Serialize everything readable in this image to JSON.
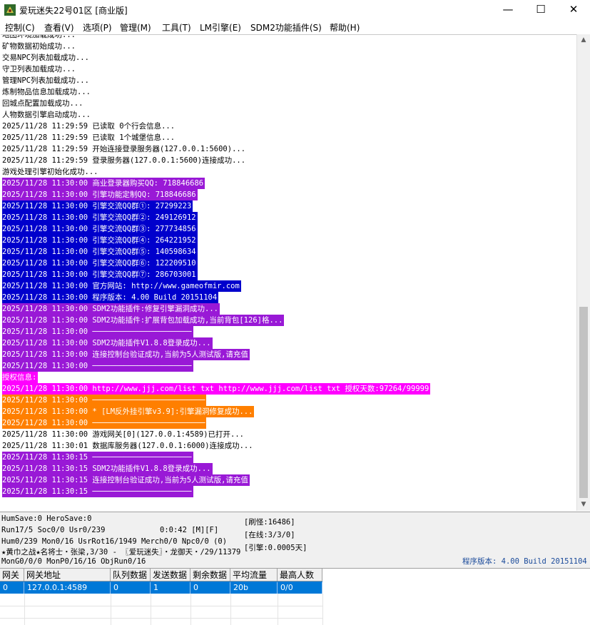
{
  "window": {
    "title": "爱玩迷失22号01区 [商业版]",
    "minimize": "—",
    "maximize": "☐",
    "close": "✕"
  },
  "menu": [
    "控制(C)",
    "查看(V)",
    "选项(P)",
    "管理(M)",
    "工具(T)",
    "LM引擎(E)",
    "SDM2功能插件(S)",
    "帮助(H)"
  ],
  "log_lines": [
    "地图环境加载成功...",
    "矿物数据初始成功...",
    "交易NPC列表加载成功...",
    "守卫列表加载成功...",
    "管理NPC列表加载成功...",
    "炼制物品信息加载成功...",
    "回城点配置加载成功...",
    "人物数据引擎启动成功...",
    "2025/11/28 11:29:59 已读取 0个行会信息...",
    "2025/11/28 11:29:59 已读取 1个城堡信息...",
    "2025/11/28 11:29:59 开始连接登录服务器(127.0.0.1:5600)...",
    "2025/11/28 11:29:59 登录服务器(127.0.0.1:5600)连接成功...",
    "游戏处理引擎初始化成功...",
    "2025/11/28 11:30:00 商业登录器购买QQ: 718846686",
    "2025/11/28 11:30:00 引擎功能定制QQ: 718846686",
    "2025/11/28 11:30:00 引擎交流QQ群①: 27299223",
    "2025/11/28 11:30:00 引擎交流QQ群②: 249126912",
    "2025/11/28 11:30:00 引擎交流QQ群③: 277734856",
    "2025/11/28 11:30:00 引擎交流QQ群④: 264221952",
    "2025/11/28 11:30:00 引擎交流QQ群⑤: 140598634",
    "2025/11/28 11:30:00 引擎交流QQ群⑥: 122209510",
    "2025/11/28 11:30:00 引擎交流QQ群⑦: 286703001",
    "2025/11/28 11:30:00 官方网站: http://www.gameofmir.com",
    "2025/11/28 11:30:00 程序版本: 4.00 Build 20151104",
    "2025/11/28 11:30:00 SDM2功能插件:修复引擎漏洞成功...",
    "2025/11/28 11:30:00 SDM2功能插件:扩展背包加载成功,当前背包[126]格...",
    "2025/11/28 11:30:00 ──────────────────────",
    "2025/11/28 11:30:00 SDM2功能插件V1.8.8登录成功...",
    "2025/11/28 11:30:00 连接控制台验证成功,当前为5人测试版,请充值",
    "2025/11/28 11:30:00 ──────────────────────",
    "授权信息:",
    "2025/11/28 11:30:00 http://www.jjj.com/list txt http://www.jjj.com/list txt 授权天数:97264/99999",
    "2025/11/28 11:30:00 ─────────────────────────",
    "2025/11/28 11:30:00 * [LM反外挂引擎v3.9]:引擎漏洞修复成功...",
    "2025/11/28 11:30:00 ─────────────────────────",
    "2025/11/28 11:30:00 游戏网关[0](127.0.0.1:4589)已打开...",
    "2025/11/28 11:30:01 数据库服务器(127.0.0.1:6000)连接成功...",
    "2025/11/28 11:30:15 ──────────────────────",
    "2025/11/28 11:30:15 SDM2功能插件V1.8.8登录成功...",
    "2025/11/28 11:30:15 连接控制台验证成功,当前为5人测试版,请充值",
    "2025/11/28 11:30:15 ──────────────────────"
  ],
  "line_colors": [
    "",
    "",
    "",
    "",
    "",
    "",
    "",
    "",
    "",
    "",
    "",
    "",
    "",
    "purple",
    "purple",
    "blue",
    "blue",
    "blue",
    "blue",
    "blue",
    "blue",
    "blue",
    "blue",
    "blue",
    "purple",
    "purple",
    "purple",
    "purple",
    "purple",
    "purple",
    "magenta",
    "magenta",
    "orange",
    "orange",
    "orange",
    "",
    "",
    "purple",
    "purple",
    "purple",
    "purple"
  ],
  "colors": {
    "blue": "#0000cc",
    "purple": "#9919d6",
    "magenta": "#ff00ff",
    "orange": "#ff7f00",
    "selection": "#0078d7"
  },
  "status": {
    "line1": "HumSave:0 HeroSave:0",
    "line2": "Run17/5 Soc0/0 Usr0/239",
    "timer": "0:0:42 [M][F]",
    "line3": "Hum0/239 Mon0/16 UsrRot16/1949 Merch0/0 Npc0/0 (0)",
    "line4": "★黄巾之战★名将士・张梁,3/30 - 〖爱玩迷失〗・龙御天・/29/11379",
    "line5": "MonG0/0/0 MonP0/16/16 ObjRun0/16",
    "refresh": "[刷怪:16486]",
    "online": "[在线:3/3/0]",
    "engine": "[引擎:0.0005天]",
    "version": "程序版本: 4.00 Build 20151104"
  },
  "gate_table": {
    "columns": [
      "网关",
      "网关地址",
      "队列数据",
      "发送数据",
      "剩余数据",
      "平均流量",
      "最高人数"
    ],
    "rows": [
      [
        "0",
        "127.0.0.1:4589",
        "0",
        "1",
        "0",
        "20b",
        "0/0"
      ]
    ]
  },
  "icons": {
    "app": "app-icon",
    "scroll_up": "scroll-up-icon",
    "scroll_down": "scroll-down-icon"
  }
}
